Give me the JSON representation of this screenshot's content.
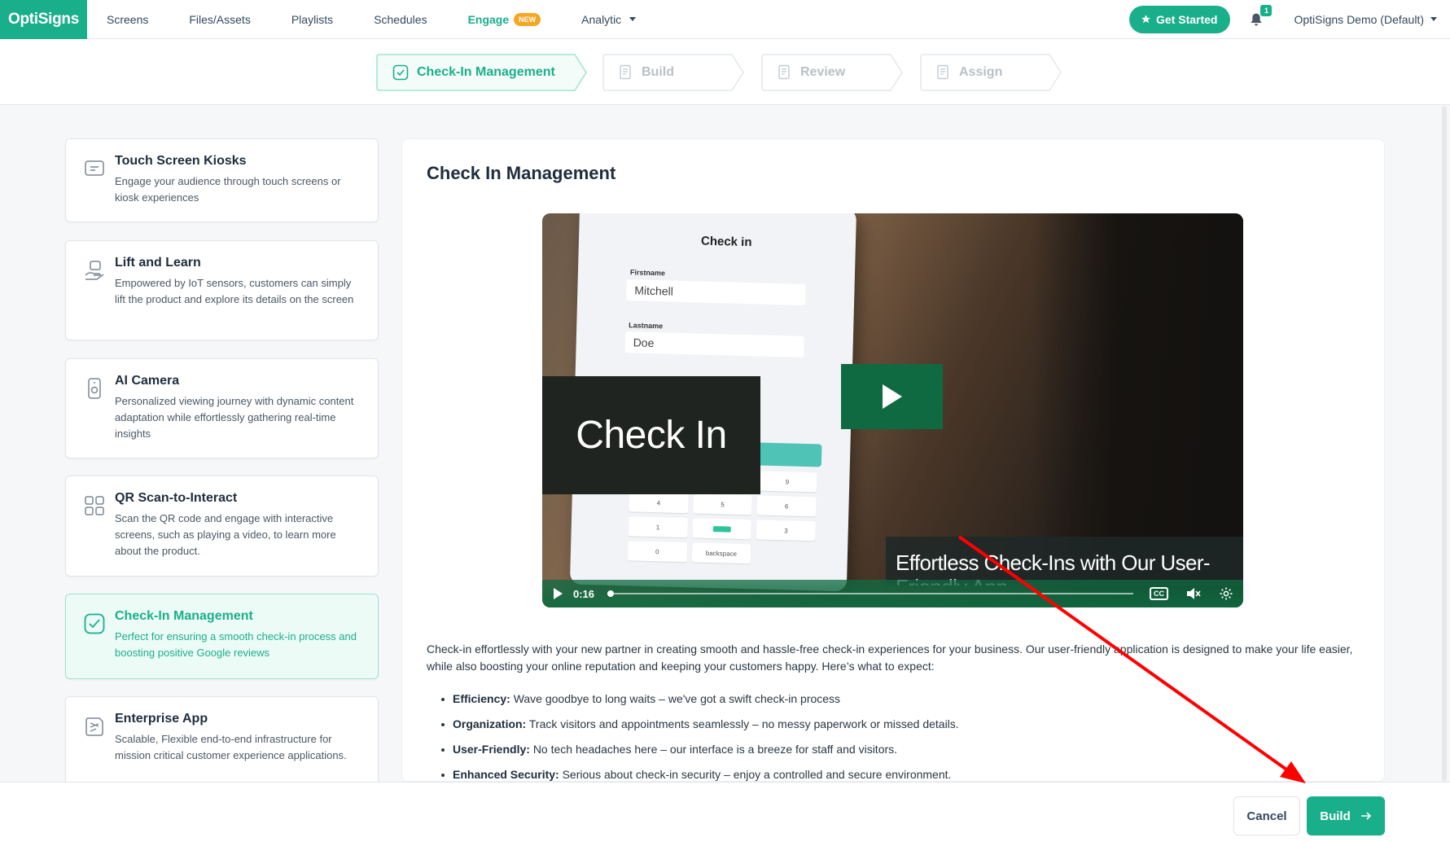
{
  "brand": {
    "logo_text": "OptiSigns",
    "accent": "#1aaf8b"
  },
  "nav": {
    "items": [
      "Screens",
      "Files/Assets",
      "Playlists",
      "Schedules"
    ],
    "engage": "Engage",
    "engage_badge": "NEW",
    "analytic": "Analytic",
    "get_started": "Get Started",
    "notifications_count": "1",
    "account": "OptiSigns Demo (Default)"
  },
  "stepper": {
    "steps": [
      {
        "label": "Check-In Management",
        "state": "active",
        "icon": "check-square-icon"
      },
      {
        "label": "Build",
        "state": "inactive",
        "icon": "document-icon"
      },
      {
        "label": "Review",
        "state": "inactive",
        "icon": "document-icon"
      },
      {
        "label": "Assign",
        "state": "inactive",
        "icon": "document-icon"
      }
    ]
  },
  "apps": [
    {
      "title": "Touch Screen Kiosks",
      "desc": "Engage your audience through touch screens or kiosk experiences",
      "icon": "kiosk-icon"
    },
    {
      "title": "Lift and Learn",
      "desc": "Empowered by IoT sensors, customers can simply lift the product and explore its details on the screen",
      "icon": "hand-box-icon"
    },
    {
      "title": "AI Camera",
      "desc": "Personalized viewing journey with dynamic content adaptation while effortlessly gathering real-time insights",
      "icon": "camera-icon"
    },
    {
      "title": "QR Scan-to-Interact",
      "desc": "Scan the QR code and engage with interactive screens, such as playing a video, to learn more about the product.",
      "icon": "qr-icon"
    },
    {
      "title": "Check-In Management",
      "desc": "Perfect for ensuring a smooth check-in process and boosting positive Google reviews",
      "icon": "check-square-icon",
      "selected": true
    },
    {
      "title": "Enterprise App",
      "desc": "Scalable, Flexible end-to-end infrastructure for mission critical customer experience applications.",
      "icon": "enterprise-icon"
    }
  ],
  "main": {
    "title": "Check In Management",
    "video": {
      "tablet_title": "Check in",
      "firstname_label": "Firstname",
      "firstname_value": "Mitchell",
      "lastname_label": "Lastname",
      "lastname_value": "Doe",
      "keys": [
        "",
        "",
        "9",
        "4",
        "5",
        "6",
        "1",
        "",
        "3",
        "0",
        "backspace",
        ""
      ],
      "overlay_title": "Check In",
      "caption_line1": "Effortless Check-Ins with Our User-",
      "caption_line2": "Friendly App",
      "time": "0:16",
      "cc_label": "CC"
    },
    "description": "Check-in effortlessly with your new partner in creating smooth and hassle-free check-in experiences for your business. Our user-friendly application is designed to make your life easier, while also boosting your online reputation and keeping your customers happy. Here’s what to expect:",
    "bullets": [
      {
        "label": "Efficiency:",
        "text": "Wave goodbye to long waits – we've got a swift check-in process"
      },
      {
        "label": "Organization:",
        "text": "Track visitors and appointments seamlessly – no messy paperwork or missed details."
      },
      {
        "label": "User-Friendly:",
        "text": "No tech headaches here – our interface is a breeze for staff and visitors."
      },
      {
        "label": "Enhanced Security:",
        "text": "Serious about check-in security – enjoy a controlled and secure environment."
      }
    ]
  },
  "footer": {
    "cancel": "Cancel",
    "build": "Build"
  }
}
